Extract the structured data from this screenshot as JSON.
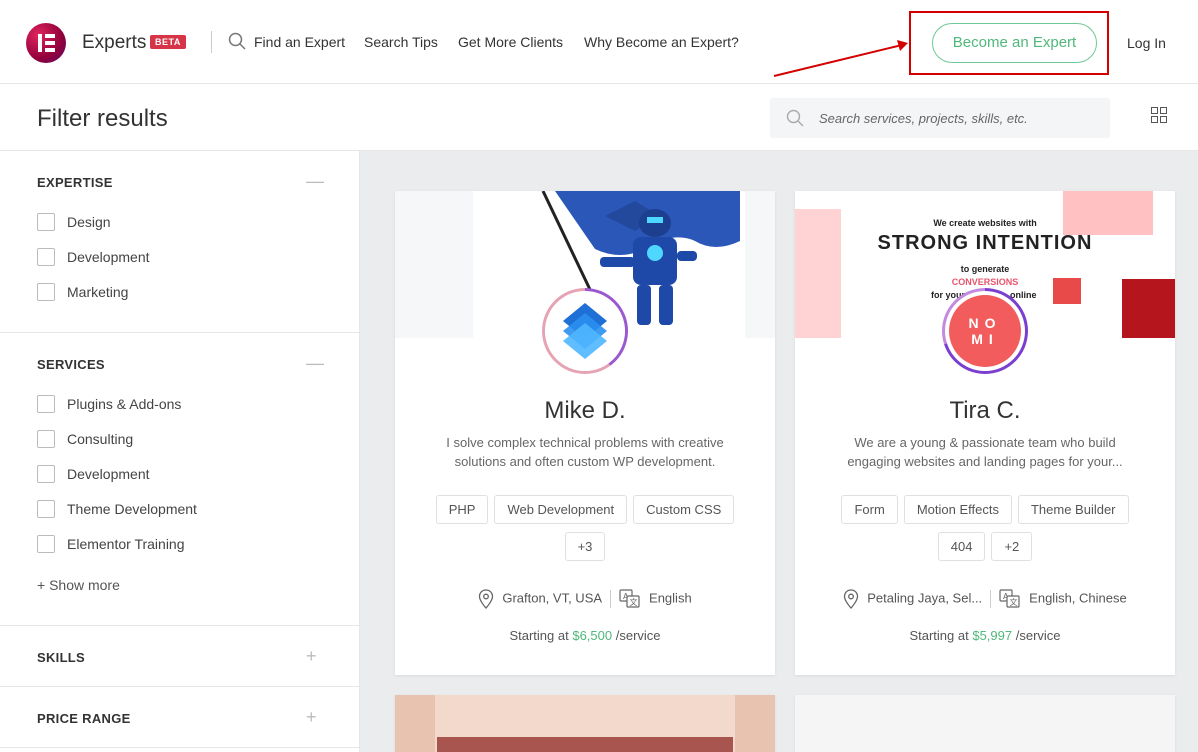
{
  "header": {
    "brand": "Experts",
    "beta_badge": "BETA",
    "nav": {
      "find_expert": "Find an Expert",
      "search_tips": "Search Tips",
      "more_clients": "Get More Clients",
      "why_become": "Why Become an Expert?"
    },
    "become_expert": "Become an Expert",
    "login": "Log In",
    "highlight_color": "#d40000",
    "accent_color": "#4fb87a"
  },
  "filterbar": {
    "title": "Filter results",
    "search_placeholder": "Search services, projects, skills, etc."
  },
  "sidebar": {
    "expertise": {
      "title": "EXPERTISE",
      "toggle": "—",
      "items": [
        {
          "label": "Design"
        },
        {
          "label": "Development"
        },
        {
          "label": "Marketing"
        }
      ]
    },
    "services": {
      "title": "SERVICES",
      "toggle": "—",
      "items": [
        {
          "label": "Plugins & Add-ons"
        },
        {
          "label": "Consulting"
        },
        {
          "label": "Development"
        },
        {
          "label": "Theme Development"
        },
        {
          "label": "Elementor Training"
        }
      ],
      "show_more": "+ Show more"
    },
    "skills": {
      "title": "SKILLS",
      "toggle": "+"
    },
    "price_range": {
      "title": "PRICE RANGE",
      "toggle": "+"
    }
  },
  "experts": [
    {
      "name": "Mike D.",
      "description": "I solve complex technical problems with creative solutions and often custom WP development.",
      "tags": [
        "PHP",
        "Web Development",
        "Custom CSS",
        "+3"
      ],
      "location": "Grafton, VT, USA",
      "languages": "English",
      "price_prefix": "Starting at",
      "price": "$6,500",
      "price_suffix": "/service"
    },
    {
      "name": "Tira C.",
      "description": "We are a young & passionate team who build engaging websites and landing pages for your...",
      "tags": [
        "Form",
        "Motion Effects",
        "Theme Builder",
        "404",
        "+2"
      ],
      "location": "Petaling Jaya, Sel...",
      "languages": "English, Chinese",
      "price_prefix": "Starting at",
      "price": "$5,997",
      "price_suffix": "/service",
      "cover": {
        "line1": "We create websites with",
        "line2": "STRONG INTENTION",
        "line3": "to generate",
        "line4": "CONVERSIONS",
        "line5": "for your",
        "line6": "online"
      },
      "avatar_text": "NO MI"
    }
  ]
}
